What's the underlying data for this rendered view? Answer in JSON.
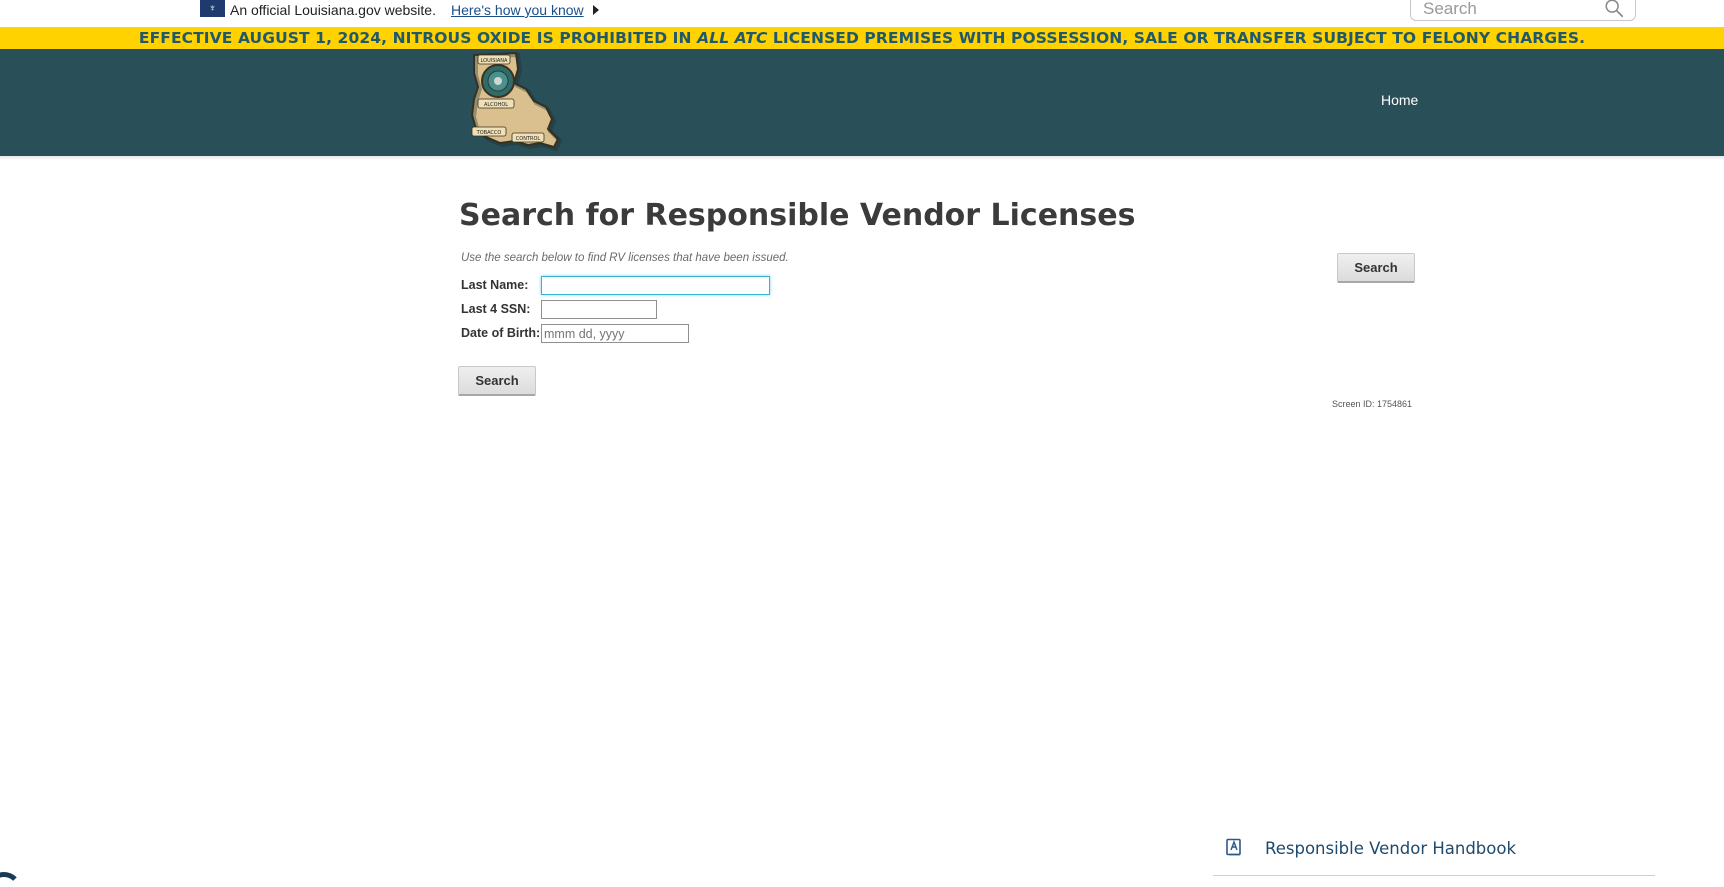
{
  "gov_bar": {
    "official_text": "An official Louisiana.gov website.",
    "how_link": "Here's how you know",
    "search_placeholder": "Search"
  },
  "alert": {
    "text_before": "EFFECTIVE AUGUST 1, 2024, NITROUS OXIDE IS PROHIBITED IN ",
    "text_emphasis": "ALL ATC",
    "text_after": " LICENSED PREMISES WITH POSSESSION, SALE OR TRANSFER SUBJECT TO FELONY CHARGES.",
    "background_color": "#ffd200",
    "text_color": "#20596b"
  },
  "header": {
    "background_color": "#294f58",
    "logo_name": "louisiana-atc-seal",
    "logo_lettering": [
      "LOUISIANA",
      "ALCOHOL",
      "TOBACCO",
      "CONTROL"
    ],
    "nav": [
      {
        "label": "Home"
      }
    ]
  },
  "main": {
    "title": "Search for Responsible Vendor Licenses",
    "instructions": "Use the search below to find RV licenses that have been issued.",
    "fields": {
      "last_name": {
        "label": "Last Name:",
        "value": "",
        "placeholder": ""
      },
      "last4_ssn": {
        "label": "Last 4 SSN:",
        "value": "",
        "placeholder": ""
      },
      "dob": {
        "label": "Date of Birth:",
        "value": "",
        "placeholder": "mmm dd, yyyy"
      }
    },
    "search_button": "Search",
    "side_search_button": "Search",
    "screen_id": "Screen ID: 1754861"
  },
  "footer": {
    "handbook_label": "Responsible Vendor Handbook",
    "handbook_icon": "book-icon"
  }
}
